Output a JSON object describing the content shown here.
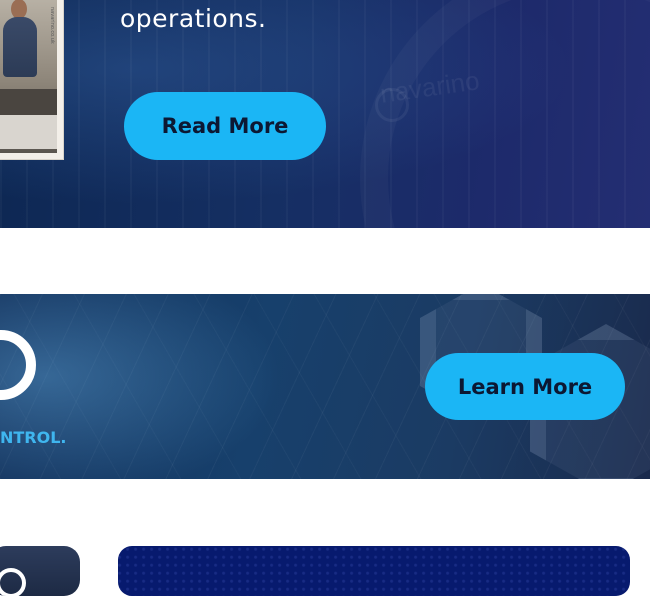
{
  "hero": {
    "text": "operations.",
    "read_more_label": "Read More",
    "watermark": "navarino",
    "photo_caption": "navarino.co.uk"
  },
  "banner": {
    "logo_text": "NTROL.",
    "learn_more_label": "Learn More"
  },
  "colors": {
    "accent": "#1bb6f5",
    "hero_bg": "#152f63",
    "banner_bg": "#17406c",
    "card_right_bg": "#071a6e"
  }
}
